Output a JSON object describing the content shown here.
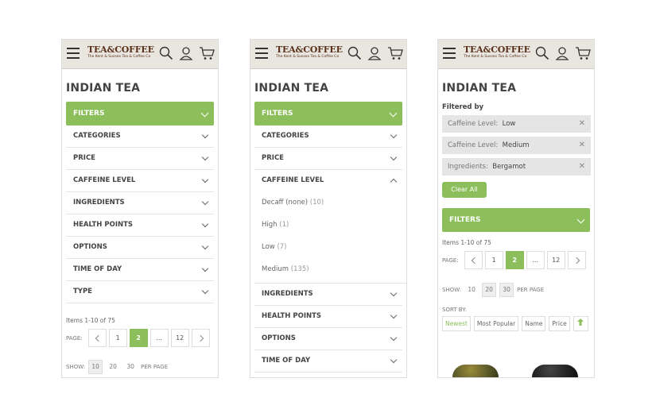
{
  "brand": {
    "name": "TEA&COFFEE",
    "tagline": "The Kent & Sussex Tea & Coffee Co"
  },
  "page_title": "INDIAN TEA",
  "filters_label": "FILTERS",
  "facets": [
    "CATEGORIES",
    "PRICE",
    "CAFFEINE LEVEL",
    "INGREDIENTS",
    "HEALTH POINTS",
    "OPTIONS",
    "TIME OF DAY",
    "TYPE"
  ],
  "caffeine_options": [
    {
      "label": "Decaff (none)",
      "count": "(10)"
    },
    {
      "label": "High",
      "count": "(1)"
    },
    {
      "label": "Low",
      "count": "(7)"
    },
    {
      "label": "Medium",
      "count": "(135)"
    }
  ],
  "items_text": "Items 1-10 of 75",
  "pager": {
    "label": "PAGE:",
    "pages": [
      "1",
      "2",
      "…",
      "12"
    ],
    "current": "2"
  },
  "show": {
    "label": "SHOW:",
    "options": [
      "10",
      "20",
      "30"
    ],
    "suffix": "PER PAGE"
  },
  "filtered_by": {
    "label": "Filtered by",
    "chips": [
      {
        "key": "Caffeine Level:",
        "value": "Low"
      },
      {
        "key": "Caffeine Level:",
        "value": "Medium"
      },
      {
        "key": "Ingredients:",
        "value": "Bergamot"
      }
    ],
    "clear_label": "Clear All",
    "remove_glyph": "✕"
  },
  "sort": {
    "label": "SORT BY:",
    "options": [
      "Newest",
      "Most Popular",
      "Name",
      "Price"
    ],
    "direction_glyph": "🡅"
  },
  "colors": {
    "accent": "#8cbf5b",
    "header_bg": "#e8e6de",
    "brand": "#5a2f1b"
  },
  "icons": [
    "menu-icon",
    "search-icon",
    "account-icon",
    "cart-icon",
    "chevron-down-icon",
    "chevron-up-icon",
    "chevron-left-icon",
    "chevron-right-icon",
    "close-icon",
    "arrow-up-icon"
  ]
}
